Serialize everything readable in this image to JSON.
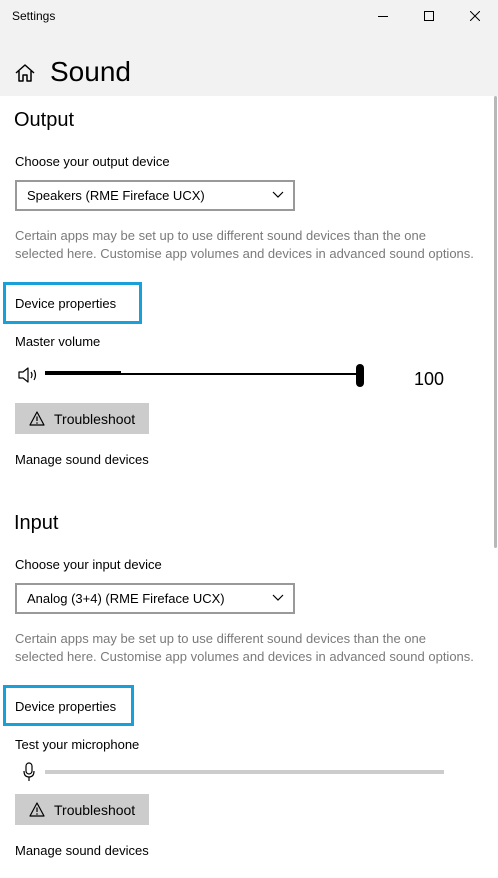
{
  "window": {
    "app_title": "Settings",
    "minimize_icon": "minimize-icon",
    "maximize_icon": "maximize-icon",
    "close_icon": "close-icon"
  },
  "header": {
    "home_icon": "home-icon",
    "page_title": "Sound"
  },
  "colors": {
    "titlebar_bg": "#f2f2f2",
    "highlight_border": "#1aa0d8",
    "note_text": "#7a7a7a",
    "button_bg": "#cccccc"
  },
  "output": {
    "section_title": "Output",
    "device_label": "Choose your output device",
    "device_value": "Speakers (RME Fireface UCX)",
    "note": "Certain apps may be set up to use different sound devices than the one selected here. Customise app volumes and devices in advanced sound options.",
    "device_properties_link": "Device properties",
    "master_volume_label": "Master volume",
    "volume_icon": "speaker-icon",
    "volume_value": "100",
    "volume_level_percent": 100,
    "volume_peak_percent": 24,
    "troubleshoot_icon": "warning-icon",
    "troubleshoot_label": "Troubleshoot",
    "manage_link": "Manage sound devices"
  },
  "input": {
    "section_title": "Input",
    "device_label": "Choose your input device",
    "device_value": "Analog (3+4) (RME Fireface UCX)",
    "note": "Certain apps may be set up to use different sound devices than the one selected here. Customise app volumes and devices in advanced sound options.",
    "device_properties_link": "Device properties",
    "test_mic_label": "Test your microphone",
    "mic_icon": "microphone-icon",
    "mic_level_percent": 0,
    "troubleshoot_icon": "warning-icon",
    "troubleshoot_label": "Troubleshoot",
    "manage_link": "Manage sound devices"
  }
}
